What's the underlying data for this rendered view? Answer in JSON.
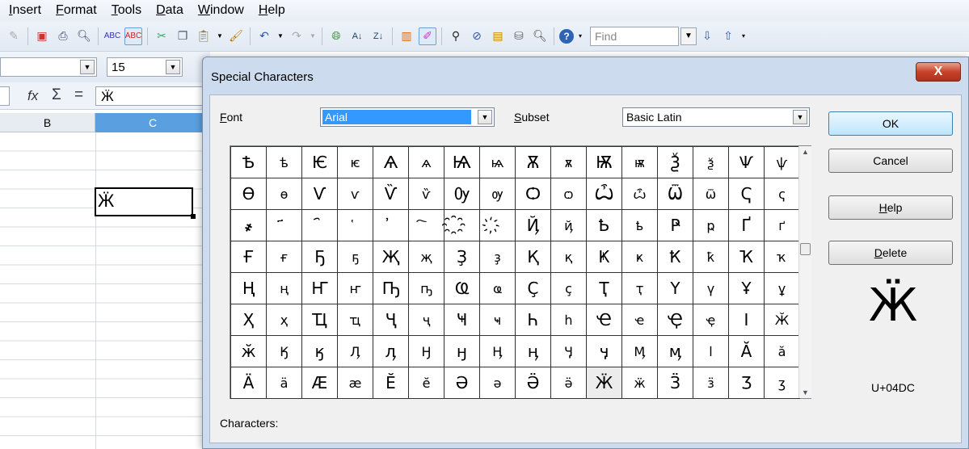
{
  "menubar": {
    "items": [
      {
        "text": "nsert",
        "u": "I"
      },
      {
        "text": "ormat",
        "u": "F",
        "pre": ""
      },
      {
        "text": "ools",
        "u": "T"
      },
      {
        "text": "ata",
        "u": "D"
      },
      {
        "text": "indow",
        "u": "W"
      },
      {
        "text": "elp",
        "u": "H"
      }
    ]
  },
  "toolbar": {
    "find_placeholder": "Find"
  },
  "formatting": {
    "font_size": "15"
  },
  "formula": {
    "fx": "fx",
    "sigma": "Σ",
    "equals": "=",
    "input_value": "Ӝ"
  },
  "sheet": {
    "col_b": "B",
    "col_c": "C",
    "active_cell_value": "Ӝ"
  },
  "dialog": {
    "title": "Special Characters",
    "close_label": "X",
    "font_label_u": "F",
    "font_label_rest": "ont",
    "font_value": "Arial",
    "subset_label_u": "S",
    "subset_label_rest": "ubset",
    "subset_value": "Basic Latin",
    "characters_label": "Characters:",
    "ok_label": "OK",
    "cancel_label": "Cancel",
    "help_label_u": "H",
    "help_label_rest": "elp",
    "delete_label_u": "D",
    "delete_label_rest": "elete",
    "preview_char": "Ӝ",
    "unicode": "U+04DC",
    "char_rows": [
      [
        "Ѣ",
        "ѣ",
        "Ѥ",
        "ѥ",
        "Ѧ",
        "ѧ",
        "Ѩ",
        "ѩ",
        "Ѫ",
        "ѫ",
        "Ѭ",
        "ѭ",
        "Ѯ",
        "ѯ",
        "Ѱ",
        "ѱ"
      ],
      [
        "Ѳ",
        "ѳ",
        "Ѵ",
        "ѵ",
        "Ѷ",
        "ѷ",
        "Ѹ",
        "ѹ",
        "Ѻ",
        "ѻ",
        "Ѽ",
        "ѽ",
        "Ѿ",
        "ѿ",
        "Ҁ",
        "ҁ"
      ],
      [
        "҂",
        "҃",
        "҄",
        "҅",
        "҆",
        "҇",
        "҈",
        "҉",
        "Ҋ",
        "ҋ",
        "Ҍ",
        "ҍ",
        "Ҏ",
        "ҏ",
        "Ґ",
        "ґ"
      ],
      [
        "Ғ",
        "ғ",
        "Ҕ",
        "ҕ",
        "Җ",
        "җ",
        "Ҙ",
        "ҙ",
        "Қ",
        "қ",
        "Ҝ",
        "ҝ",
        "Ҟ",
        "ҟ",
        "Ҡ",
        "ҡ"
      ],
      [
        "Ң",
        "ң",
        "Ҥ",
        "ҥ",
        "Ҧ",
        "ҧ",
        "Ҩ",
        "ҩ",
        "Ҫ",
        "ҫ",
        "Ҭ",
        "ҭ",
        "Ү",
        "ү",
        "Ұ",
        "ұ"
      ],
      [
        "Ҳ",
        "ҳ",
        "Ҵ",
        "ҵ",
        "Ҷ",
        "ҷ",
        "Ҹ",
        "ҹ",
        "Һ",
        "һ",
        "Ҽ",
        "ҽ",
        "Ҿ",
        "ҿ",
        "Ӏ",
        "Ӂ"
      ],
      [
        "ӂ",
        "Ӄ",
        "ӄ",
        "Ӆ",
        "ӆ",
        "Ӈ",
        "ӈ",
        "Ӊ",
        "ӊ",
        "Ӌ",
        "ӌ",
        "Ӎ",
        "ӎ",
        "ӏ",
        "Ӑ",
        "ӑ"
      ],
      [
        "Ӓ",
        "ӓ",
        "Ӕ",
        "ӕ",
        "Ӗ",
        "ӗ",
        "Ә",
        "ә",
        "Ӛ",
        "ӛ",
        "Ӝ",
        "ӝ",
        "Ӟ",
        "ӟ",
        "Ӡ",
        "ӡ"
      ]
    ],
    "selected_row": 7,
    "selected_col": 10
  },
  "colors": {
    "accent": "#3399ff",
    "selected_col_header": "#5aa0e0",
    "close_red": "#c8432a"
  }
}
